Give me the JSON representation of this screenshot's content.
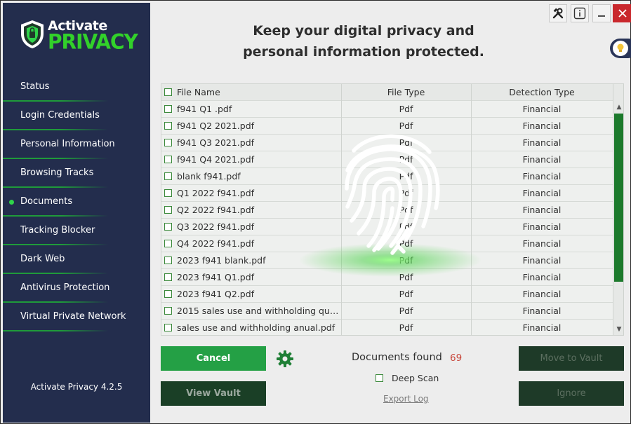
{
  "app": {
    "brand_line1": "Activate",
    "brand_line2": "PRIVACY",
    "version": "Activate Privacy 4.2.5",
    "headline_line1": "Keep your digital privacy and",
    "headline_line2": "personal information protected."
  },
  "sidebar": {
    "items": [
      {
        "label": "Status",
        "active": false
      },
      {
        "label": "Login Credentials",
        "active": false
      },
      {
        "label": "Personal Information",
        "active": false
      },
      {
        "label": "Browsing Tracks",
        "active": false
      },
      {
        "label": "Documents",
        "active": true
      },
      {
        "label": "Tracking Blocker",
        "active": false
      },
      {
        "label": "Dark Web",
        "active": false
      },
      {
        "label": "Antivirus Protection",
        "active": false
      },
      {
        "label": "Virtual Private Network",
        "active": false
      }
    ]
  },
  "table": {
    "columns": [
      "File Name",
      "File Type",
      "Detection Type"
    ],
    "rows": [
      [
        "f941 Q1 .pdf",
        "Pdf",
        "Financial"
      ],
      [
        "f941 Q2 2021.pdf",
        "Pdf",
        "Financial"
      ],
      [
        "f941 Q3 2021.pdf",
        "Pdf",
        "Financial"
      ],
      [
        "f941 Q4 2021.pdf",
        "Pdf",
        "Financial"
      ],
      [
        "blank f941.pdf",
        "Pdf",
        "Financial"
      ],
      [
        "Q1 2022 f941.pdf",
        "Pdf",
        "Financial"
      ],
      [
        "Q2 2022 f941.pdf",
        "Pdf",
        "Financial"
      ],
      [
        "Q3 2022 f941.pdf",
        "Pdf",
        "Financial"
      ],
      [
        "Q4 2022 f941.pdf",
        "Pdf",
        "Financial"
      ],
      [
        "2023 f941 blank.pdf",
        "Pdf",
        "Financial"
      ],
      [
        "2023 f941 Q1.pdf",
        "Pdf",
        "Financial"
      ],
      [
        "2023 f941 Q2.pdf",
        "Pdf",
        "Financial"
      ],
      [
        "2015 sales use and withholding qua…",
        "Pdf",
        "Financial"
      ],
      [
        "sales use and withholding anual.pdf",
        "Pdf",
        "Financial"
      ]
    ]
  },
  "controls": {
    "cancel": "Cancel",
    "view_vault": "View Vault",
    "move_to_vault": "Move to Vault",
    "ignore": "Ignore",
    "documents_found_label": "Documents found",
    "documents_found_count": "69",
    "deep_scan": "Deep Scan",
    "export_log": "Export Log"
  },
  "colors": {
    "sidebar_bg": "#232d4d",
    "accent_green": "#24a045",
    "brand_green": "#32d12a",
    "close_red": "#c9282d",
    "count_red": "#c8463a"
  },
  "icons": {
    "tools": "tools-icon",
    "info": "info-icon",
    "minimize": "minimize-icon",
    "close": "close-icon",
    "settings": "gear-icon",
    "scan": "fingerprint-icon",
    "theme": "lightbulb-icon"
  }
}
